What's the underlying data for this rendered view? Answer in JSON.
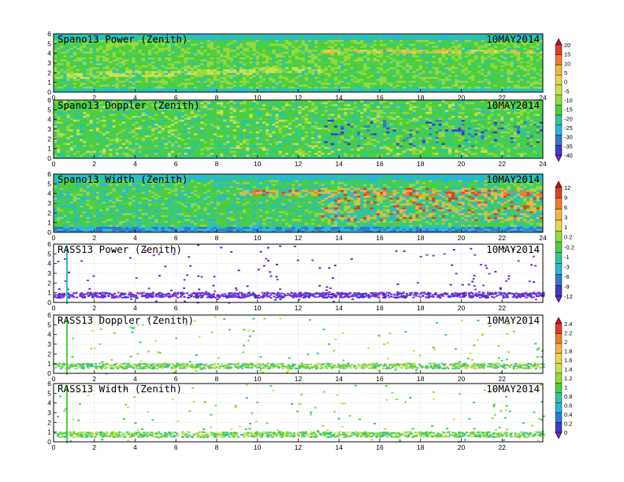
{
  "date_label": "10MAY2014",
  "colorbars": [
    {
      "name": "spano-power-doppler-colorbar",
      "labels": [
        "20",
        "15",
        "10",
        "5",
        "0",
        "-5",
        "-10",
        "-15",
        "-20",
        "-25",
        "-30",
        "-35",
        "-40"
      ],
      "colors": [
        "#c8102e",
        "#e23b2a",
        "#f07a2a",
        "#f5b342",
        "#e5d74b",
        "#c9e34f",
        "#93da3e",
        "#4bcf3c",
        "#2fc59b",
        "#2ab7d8",
        "#2f79d5",
        "#3a3ad0",
        "#7a22c9"
      ]
    },
    {
      "name": "spano-width-colorbar",
      "labels": [
        "12",
        "9",
        "6",
        "3",
        "1",
        "0.2",
        "-0.2",
        "-1",
        "-3",
        "-6",
        "-9",
        "-12"
      ],
      "colors": [
        "#c8102e",
        "#e23b2a",
        "#f07a2a",
        "#f5b342",
        "#e5d74b",
        "#93da3e",
        "#4bcf3c",
        "#2fc59b",
        "#2ab7d8",
        "#2f79d5",
        "#3a3ad0",
        "#7a22c9"
      ]
    },
    {
      "name": "rass-doppler-width-colorbar",
      "labels": [
        "2.4",
        "2.2",
        "2",
        "1.8",
        "1.6",
        "1.4",
        "1.2",
        "1",
        "0.8",
        "0.6",
        "0.4",
        "0.2",
        "0"
      ],
      "colors": [
        "#c8102e",
        "#e23b2a",
        "#f07a2a",
        "#f5b342",
        "#e5d74b",
        "#c9e34f",
        "#93da3e",
        "#4bcf3c",
        "#2fc59b",
        "#2ab7d8",
        "#2f79d5",
        "#3a3ad0",
        "#7a22c9"
      ]
    }
  ],
  "chart_data": [
    {
      "type": "heatmap",
      "title": "Spano13 Power (Zenith)",
      "xlim": [
        0,
        24
      ],
      "ylim": [
        0,
        6
      ],
      "xticks": [
        "0",
        "2",
        "4",
        "6",
        "8",
        "10",
        "12",
        "14",
        "16",
        "18",
        "20",
        "22",
        "24"
      ],
      "yticks": [
        "0",
        "1",
        "2",
        "3",
        "4",
        "5",
        "6"
      ],
      "grid": true,
      "colorbar": "spano-power-doppler-colorbar"
    },
    {
      "type": "heatmap",
      "title": "Spano13 Doppler (Zenith)",
      "xlim": [
        0,
        24
      ],
      "ylim": [
        0,
        6
      ],
      "xticks": [
        "0",
        "2",
        "4",
        "6",
        "8",
        "10",
        "12",
        "14",
        "16",
        "18",
        "20",
        "22",
        "24"
      ],
      "yticks": [
        "0",
        "1",
        "2",
        "3",
        "4",
        "5",
        "6"
      ],
      "grid": true,
      "colorbar": "spano-power-doppler-colorbar"
    },
    {
      "type": "heatmap",
      "title": "Spano13 Width (Zenith)",
      "xlim": [
        0,
        24
      ],
      "ylim": [
        0,
        6
      ],
      "xticks": [
        "0",
        "2",
        "4",
        "6",
        "8",
        "10",
        "12",
        "14",
        "16",
        "18",
        "20",
        "22",
        "24"
      ],
      "yticks": [
        "0",
        "1",
        "2",
        "3",
        "4",
        "5",
        "6"
      ],
      "grid": true,
      "colorbar": "spano-width-colorbar"
    },
    {
      "type": "heatmap",
      "title": "RASS13 Power (Zenith)",
      "xlim": [
        0,
        24
      ],
      "ylim": [
        0,
        6
      ],
      "xticks": [
        "0",
        "2",
        "4",
        "6",
        "8",
        "10",
        "12",
        "14",
        "16",
        "18",
        "20",
        "22"
      ],
      "yticks": [
        "0",
        "1",
        "2",
        "3",
        "4",
        "5",
        "6"
      ],
      "grid": true,
      "colorbar": "spano-width-colorbar"
    },
    {
      "type": "heatmap",
      "title": "RASS13 Doppler (Zenith)",
      "xlim": [
        0,
        24
      ],
      "ylim": [
        0,
        6
      ],
      "xticks": [
        "0",
        "2",
        "4",
        "6",
        "8",
        "10",
        "12",
        "14",
        "16",
        "18",
        "20",
        "22"
      ],
      "yticks": [
        "0",
        "1",
        "2",
        "3",
        "4",
        "5",
        "6"
      ],
      "grid": true,
      "colorbar": "rass-doppler-width-colorbar"
    },
    {
      "type": "heatmap",
      "title": "RASS13 Width (Zenith)",
      "xlim": [
        0,
        24
      ],
      "ylim": [
        0,
        6
      ],
      "xticks": [
        "0",
        "2",
        "4",
        "6",
        "8",
        "10",
        "12",
        "14",
        "16",
        "18",
        "20",
        "22"
      ],
      "yticks": [
        "0",
        "1",
        "2",
        "3",
        "4",
        "5",
        "6"
      ],
      "grid": true,
      "colorbar": "rass-doppler-width-colorbar"
    }
  ]
}
